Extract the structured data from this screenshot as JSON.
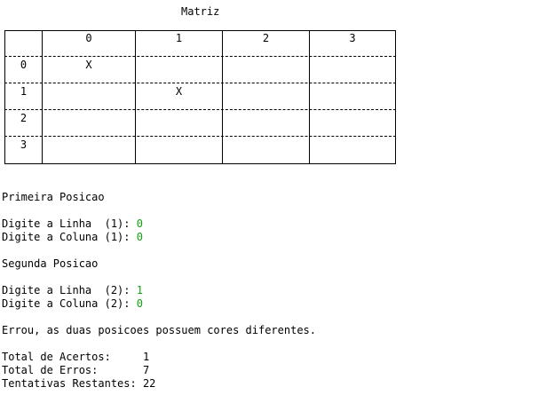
{
  "matrix": {
    "title": "Matriz",
    "col_headers": [
      "0",
      "1",
      "2",
      "3"
    ],
    "row_headers": [
      "0",
      "1",
      "2",
      "3"
    ],
    "cells": [
      [
        "X",
        "",
        "",
        ""
      ],
      [
        "",
        "X",
        "",
        ""
      ],
      [
        "",
        "",
        "",
        ""
      ],
      [
        "",
        "",
        "",
        ""
      ]
    ]
  },
  "console": {
    "first_position_heading": "Primeira Posicao",
    "row_prompt_1": "Digite a Linha  (1): ",
    "row_value_1": "0",
    "col_prompt_1": "Digite a Coluna (1): ",
    "col_value_1": "0",
    "second_position_heading": "Segunda Posicao",
    "row_prompt_2": "Digite a Linha  (2): ",
    "row_value_2": "1",
    "col_prompt_2": "Digite a Coluna (2): ",
    "col_value_2": "0",
    "result_message": "Errou, as duas posicoes possuem cores diferentes.",
    "total_hits_label": "Total de Acertos:     ",
    "total_hits_value": "1",
    "total_errors_label": "Total de Erros:       ",
    "total_errors_value": "7",
    "remaining_label": "Tentativas Restantes: ",
    "remaining_value": "22"
  },
  "colors": {
    "background": "#ffffff",
    "text": "#000000",
    "input_value": "#13a10e"
  }
}
